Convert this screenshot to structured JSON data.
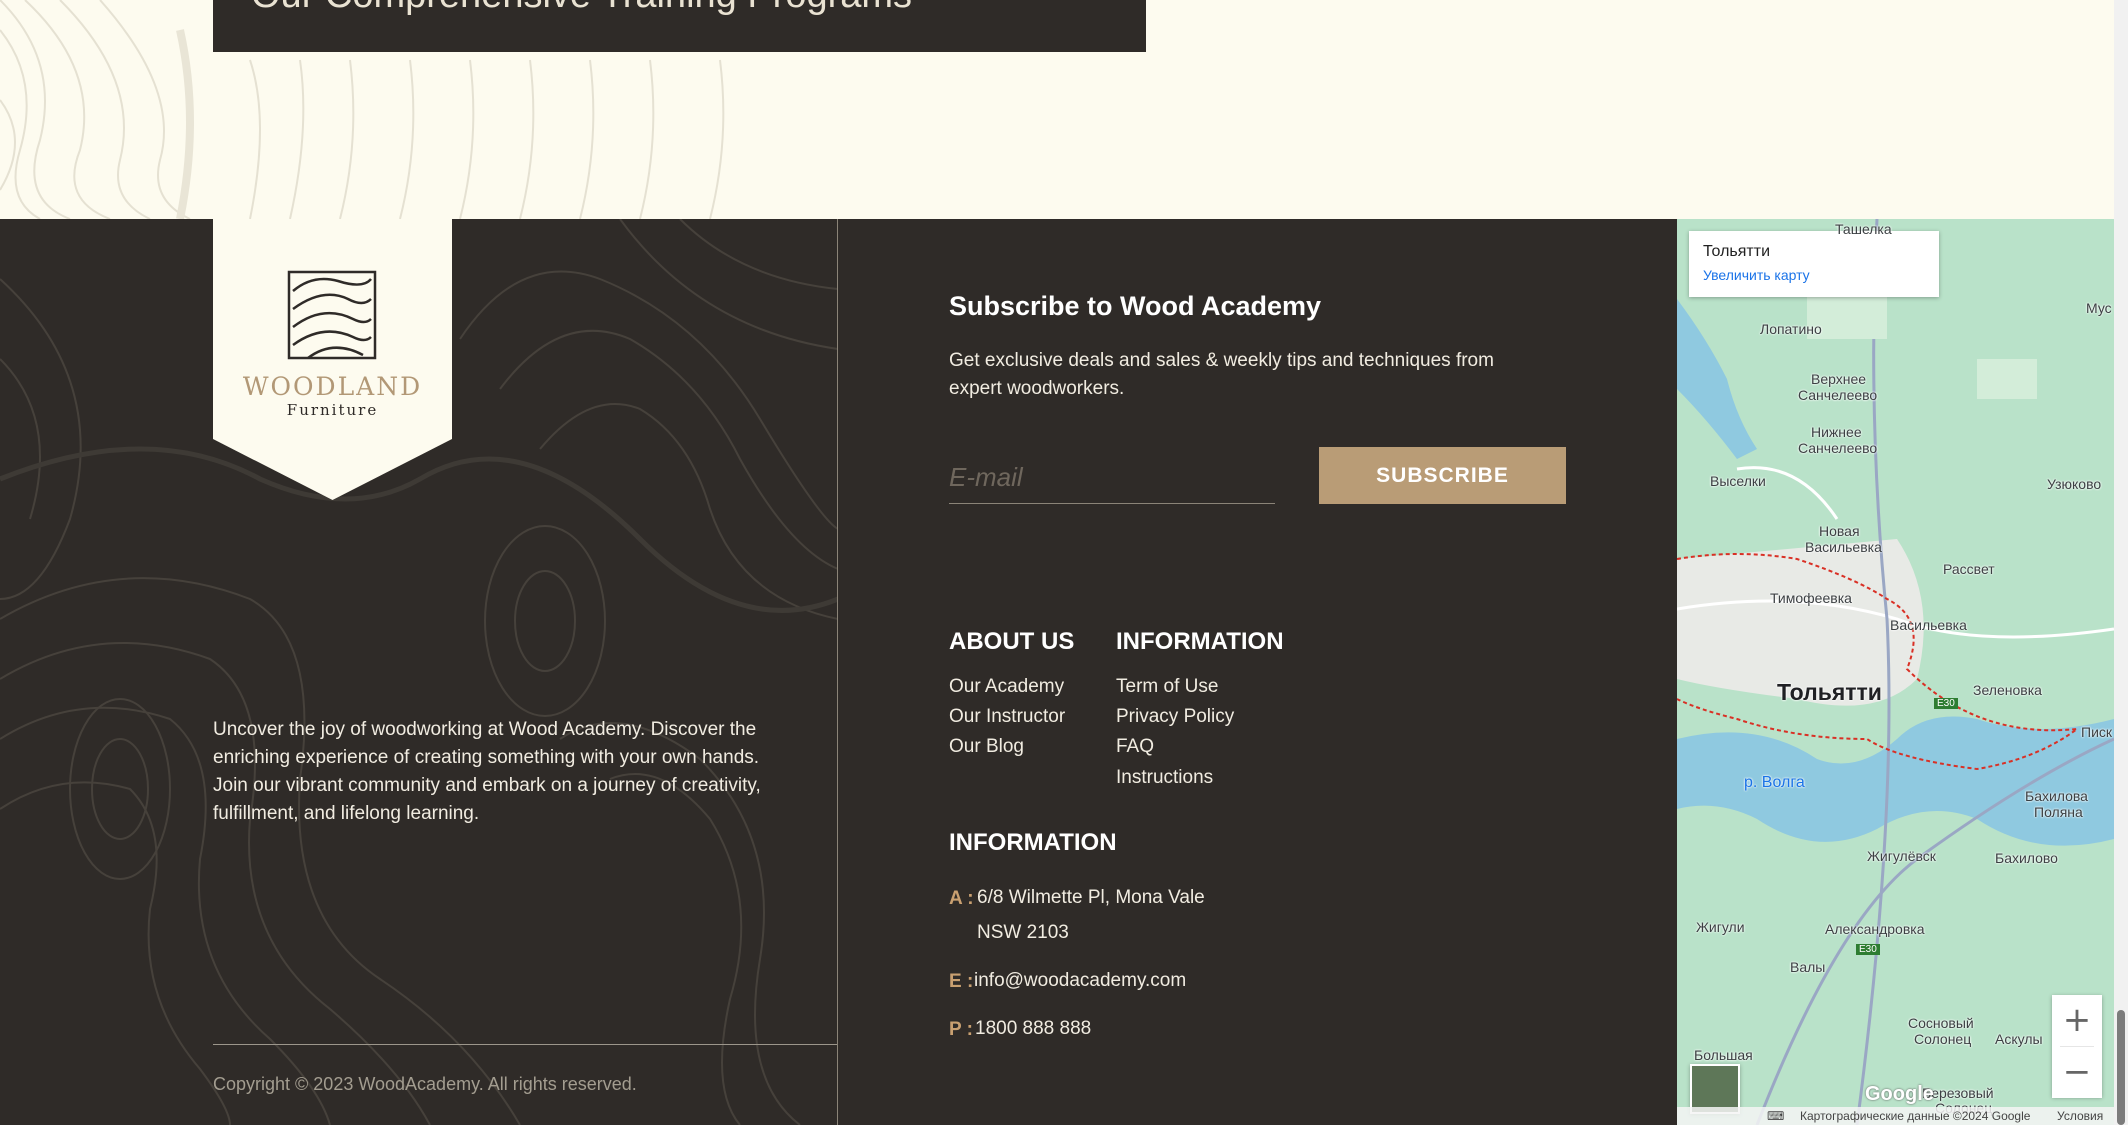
{
  "banner": {
    "text": "Our Comprehensive Training Programs"
  },
  "logo": {
    "word": "WOODLAND",
    "sub": "Furniture"
  },
  "about_text": "Uncover the joy of woodworking at Wood Academy. Discover the enriching experience of creating something with your own hands. Join our vibrant community and embark on a journey of creativity, fulfillment, and lifelong learning.",
  "copyright": "Copyright © 2023 WoodAcademy. All rights reserved.",
  "subscribe": {
    "title": "Subscribe to Wood Academy",
    "text": "Get exclusive deals and sales & weekly tips and techniques from expert woodworkers.",
    "placeholder": "E-mail",
    "button": "SUBSCRIBE"
  },
  "about_us": {
    "title": "ABOUT US",
    "links": [
      "Our Academy",
      "Our Instructor",
      "Our Blog"
    ]
  },
  "information": {
    "title": "INFORMATION",
    "links": [
      "Term of Use",
      "Privacy Policy",
      "FAQ",
      "Instructions"
    ]
  },
  "contact": {
    "title": "INFORMATION",
    "address_label": "A :",
    "address_line1": "6/8 Wilmette Pl, Mona Vale",
    "address_line2": "NSW 2103",
    "email_label": "E :",
    "email": "info@woodacademy.com",
    "phone_label": "P :",
    "phone": "1800 888 888"
  },
  "map": {
    "card_title": "Тольятти",
    "card_link": "Увеличить карту",
    "city": "Тольятти",
    "river": "р. Волга",
    "labels": {
      "tashelka": "Ташелка",
      "lopatino": "Лопатино",
      "mus": "Мус",
      "verkhnee": "Верхнее",
      "sanchelevo1": "Санчелеево",
      "nizhnee": "Нижнее",
      "sanchelevo2": "Санчелеево",
      "vyselki": "Выселки",
      "uzyukovo": "Узюково",
      "novaya": "Новая",
      "vasilevka": "Васильевка",
      "rassvet": "Рассвет",
      "timofeevka": "Тимофеевка",
      "vasilevka2": "Васильевка",
      "zelenovka": "Зеленовка",
      "pisk": "Писк",
      "bakhilova": "Бахилова",
      "polyana": "Поляна",
      "zhigulevsk": "Жигулёвск",
      "bakhilovo": "Бахилово",
      "zhiguli": "Жигули",
      "aleksandrovka": "Александровка",
      "valy": "Валы",
      "sosnovy": "Сосновый",
      "solonets": "Солонец",
      "askuly": "Аскулы",
      "bolshaya": "Большая",
      "berezovy": "Березовый",
      "solonets2": "Солонец",
      "e30a": "E30",
      "e30b": "E30"
    },
    "google": "Google",
    "attribution": "Картографические данные ©2024 Google",
    "terms": "Условия",
    "zoom_in": "+",
    "zoom_out": "−"
  },
  "colors": {
    "footer_bg": "#2f2b28",
    "accent": "#b99c76",
    "cream": "#fdfbef"
  }
}
